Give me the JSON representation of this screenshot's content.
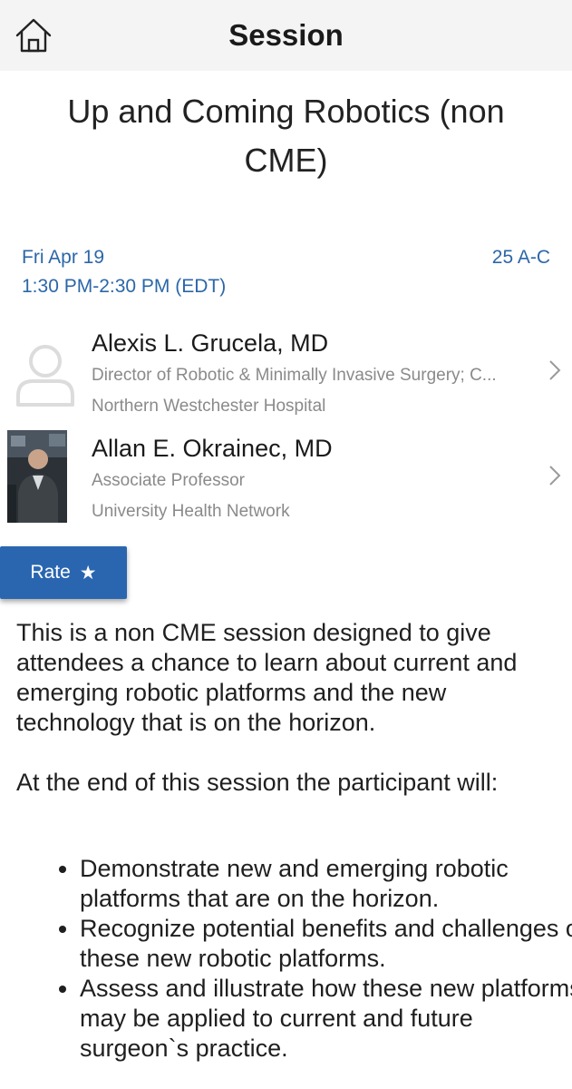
{
  "header": {
    "title": "Session",
    "home_icon": "home-icon"
  },
  "session": {
    "title": "Up and Coming Robotics (non CME)",
    "date": "Fri Apr 19",
    "time": "1:30 PM-2:30 PM (EDT)",
    "room": "25 A-C",
    "accent_color": "#2c67a8"
  },
  "speakers": [
    {
      "name": "Alexis L. Grucela, MD",
      "role": "Director of Robotic & Minimally Invasive Surgery; C...",
      "organization": "Northern Westchester Hospital",
      "avatar": "placeholder-person-icon"
    },
    {
      "name": "Allan E. Okrainec, MD",
      "role": "Associate Professor",
      "organization": "University Health Network",
      "avatar": "speaker-photo"
    }
  ],
  "rate": {
    "label": "Rate",
    "icon": "star-icon",
    "color": "#2a66b0"
  },
  "description": {
    "paragraph1": "This is a non CME session designed to give attendees a chance to learn about current and emerging robotic platforms and the new technology that is on the horizon.",
    "paragraph2": "At the end of this session the participant will:",
    "objectives": [
      "Demonstrate new and emerging robotic platforms that are on the horizon.",
      "Recognize potential benefits and challenges of these new robotic platforms.",
      "Assess and illustrate how these new platforms may be applied to current and future surgeon`s practice."
    ]
  }
}
